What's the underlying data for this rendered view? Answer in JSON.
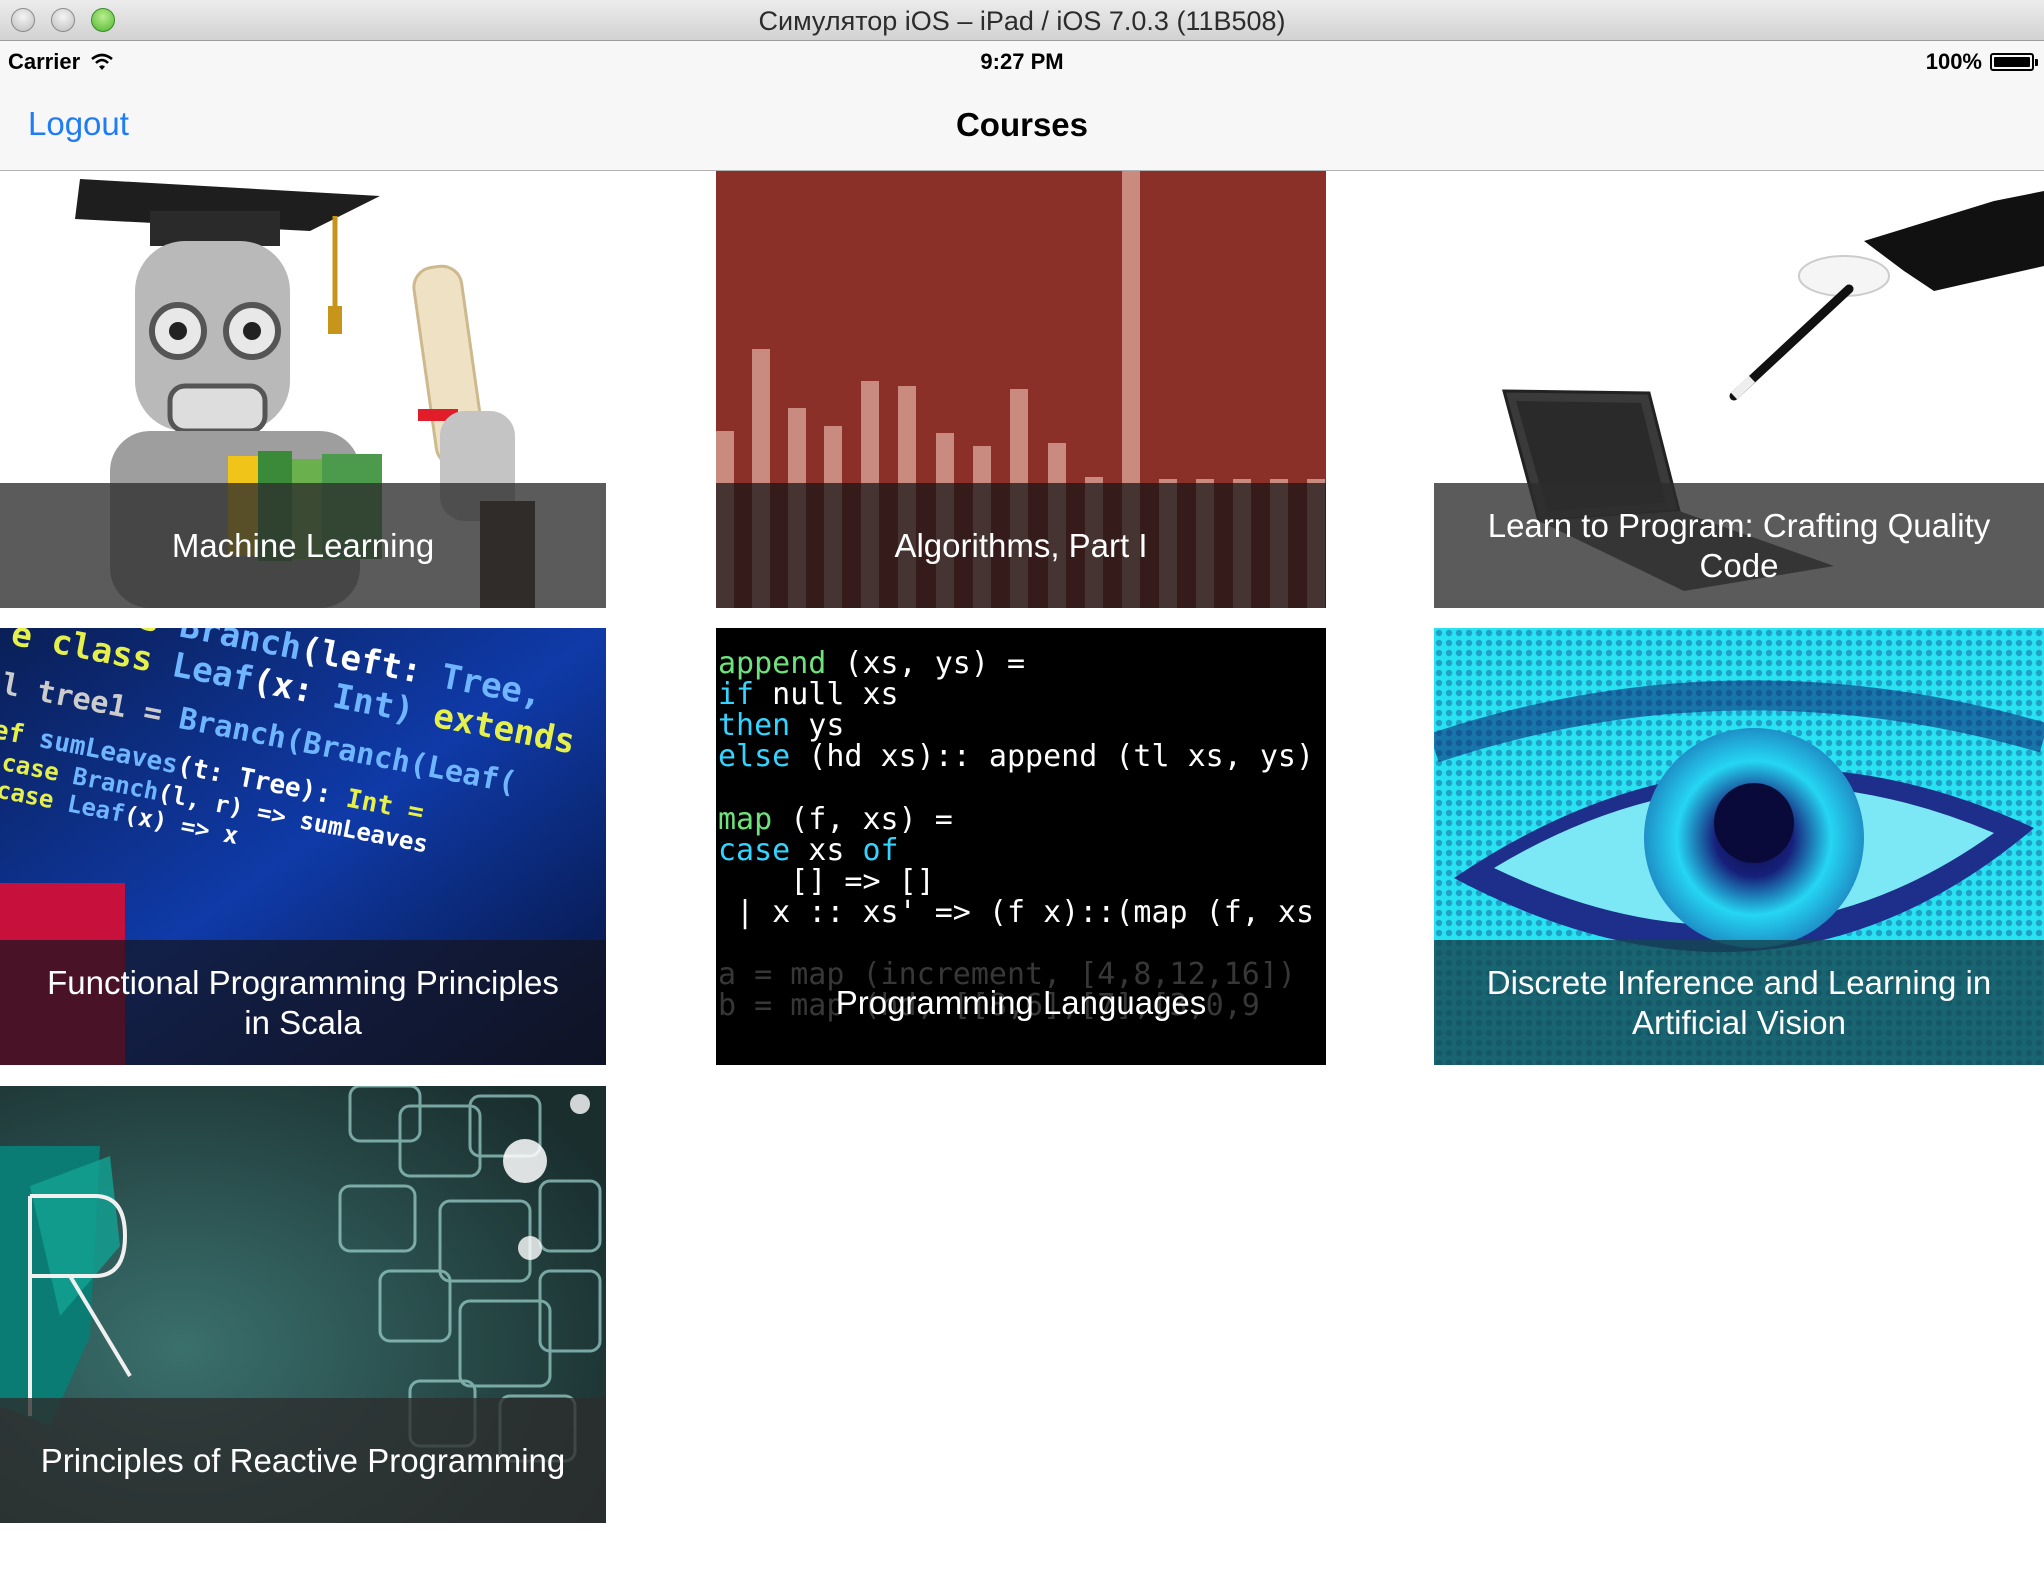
{
  "window": {
    "title": "Симулятор iOS – iPad / iOS 7.0.3 (11B508)"
  },
  "status_bar": {
    "carrier": "Carrier",
    "time": "9:27 PM",
    "battery": "100%"
  },
  "nav": {
    "left_button": "Logout",
    "title": "Courses"
  },
  "courses": [
    {
      "title": "Machine Learning"
    },
    {
      "title": "Algorithms, Part I"
    },
    {
      "title": "Learn to Program: Crafting Quality Code"
    },
    {
      "title": "Functional Programming Principles in Scala"
    },
    {
      "title": "Programming Languages"
    },
    {
      "title": "Discrete Inference and Learning in Artificial Vision"
    },
    {
      "title": "Principles of Reactive Programming"
    }
  ]
}
